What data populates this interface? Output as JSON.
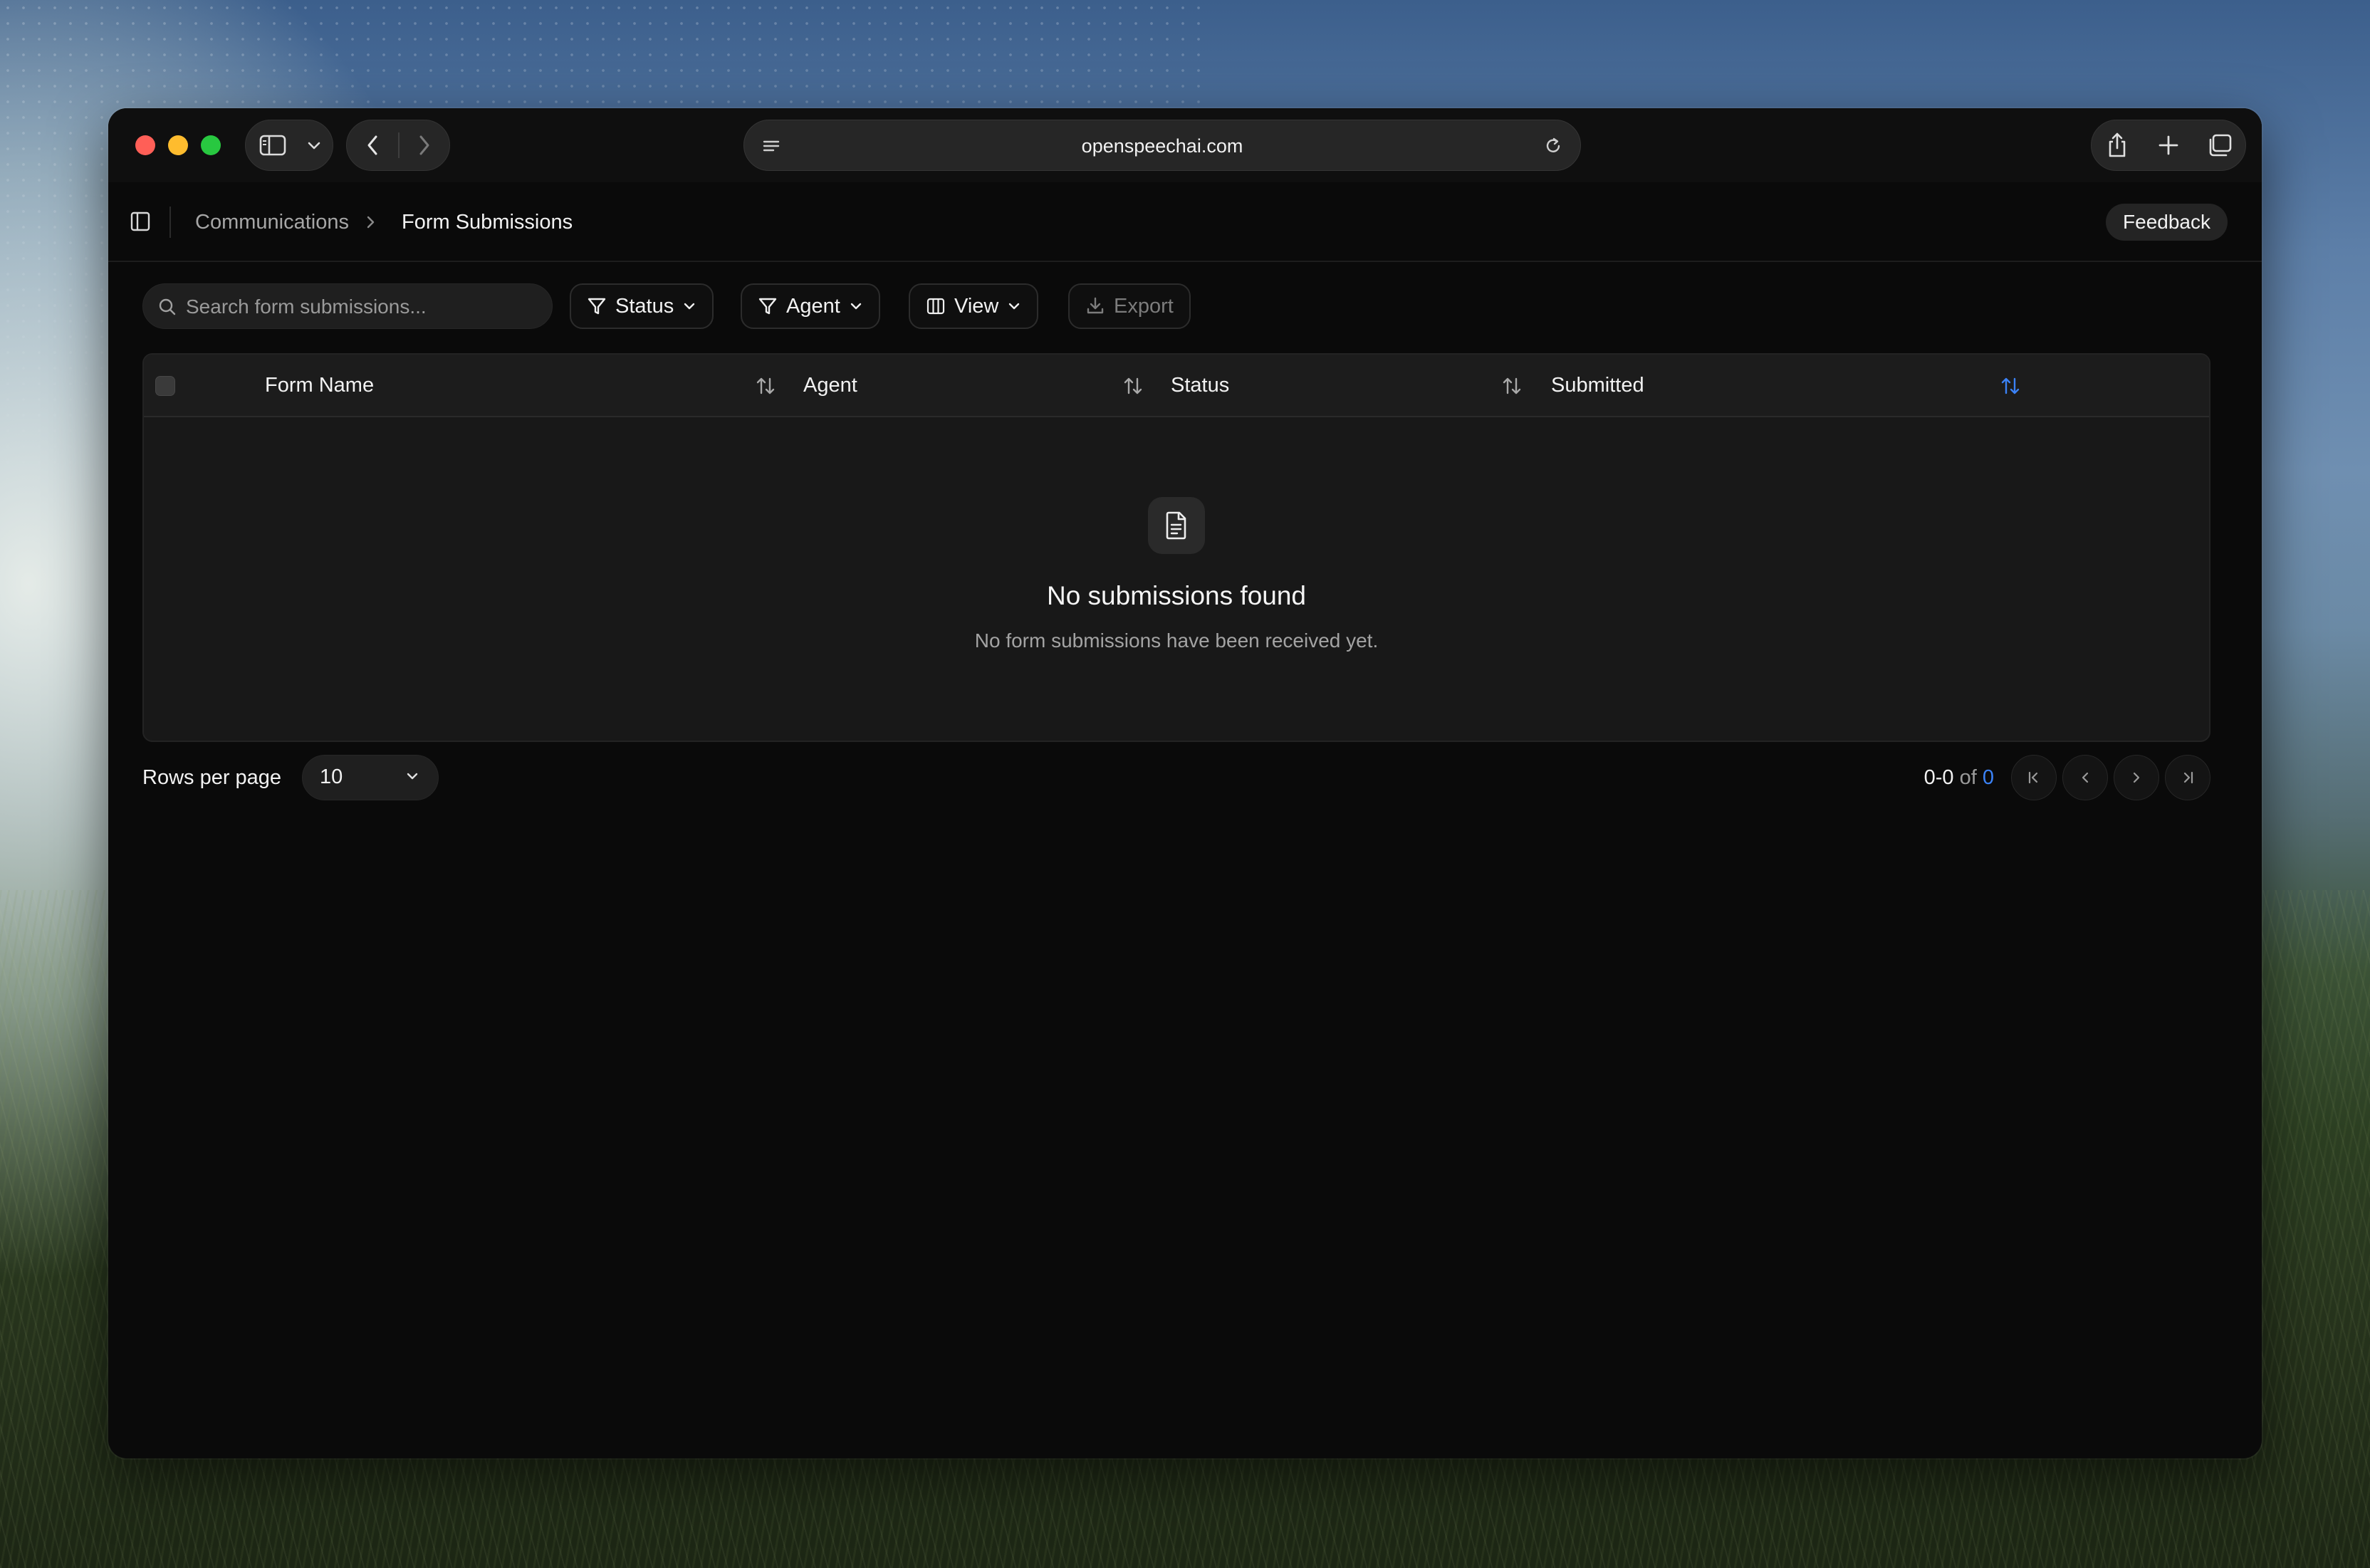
{
  "browser": {
    "url": "openspeechai.com"
  },
  "header": {
    "breadcrumb": [
      "Communications",
      "Form Submissions"
    ],
    "feedback_label": "Feedback"
  },
  "toolbar": {
    "search_placeholder": "Search form submissions...",
    "filters": {
      "status_label": "Status",
      "agent_label": "Agent",
      "view_label": "View",
      "export_label": "Export"
    }
  },
  "table": {
    "columns": [
      "Form Name",
      "Agent",
      "Status",
      "Submitted"
    ],
    "rows": [],
    "empty_state": {
      "icon": "document-icon",
      "title": "No submissions found",
      "subtitle": "No form submissions have been received yet."
    }
  },
  "pagination": {
    "rows_per_page_label": "Rows per page",
    "rows_per_page": "10",
    "range": "0-0",
    "of_label": "of",
    "total": "0"
  },
  "colors": {
    "accent": "#3b82f6",
    "background": "#0a0a0a",
    "table_bg": "#181818"
  }
}
